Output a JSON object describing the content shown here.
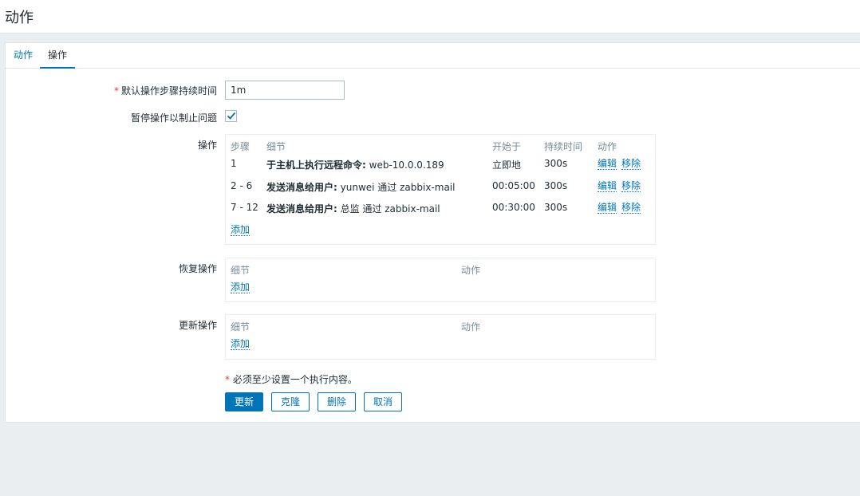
{
  "page_title": "动作",
  "tabs": [
    {
      "label": "动作"
    },
    {
      "label": "操作"
    }
  ],
  "form": {
    "duration_label": "默认操作步骤持续时间",
    "duration_value": "1m",
    "pause_label": "暂停操作以制止问题",
    "pause_checked": true,
    "required_mark": "*"
  },
  "operations": {
    "label": "操作",
    "headers": {
      "step": "步骤",
      "details": "细节",
      "start": "开始于",
      "duration": "持续时间",
      "action": "动作"
    },
    "rows": [
      {
        "step": "1",
        "details_bold": "于主机上执行远程命令:",
        "details_rest": " web-10.0.0.189",
        "start": "立即地",
        "duration": "300s",
        "edit": "编辑",
        "remove": "移除"
      },
      {
        "step": "2 - 6",
        "details_bold": "发送消息给用户:",
        "details_rest": " yunwei 通过 zabbix-mail",
        "start": "00:05:00",
        "duration": "300s",
        "edit": "编辑",
        "remove": "移除"
      },
      {
        "step": "7 - 12",
        "details_bold": "发送消息给用户:",
        "details_rest": " 总监 通过 zabbix-mail",
        "start": "00:30:00",
        "duration": "300s",
        "edit": "编辑",
        "remove": "移除"
      }
    ],
    "add": "添加"
  },
  "recovery": {
    "label": "恢复操作",
    "headers": {
      "details": "细节",
      "action": "动作"
    },
    "add": "添加"
  },
  "update": {
    "label": "更新操作",
    "headers": {
      "details": "细节",
      "action": "动作"
    },
    "add": "添加"
  },
  "note": {
    "mark": "*",
    "text": " 必须至少设置一个执行内容。"
  },
  "buttons": {
    "update": "更新",
    "clone": "克隆",
    "delete": "删除",
    "cancel": "取消"
  },
  "colors": {
    "accent": "#0275b8",
    "required": "#e33734"
  }
}
